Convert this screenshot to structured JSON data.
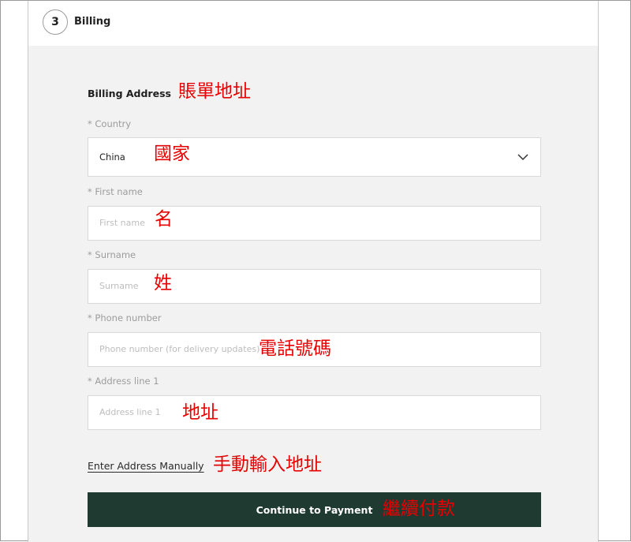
{
  "step": {
    "number": "3",
    "title": "Billing"
  },
  "billing": {
    "section_title": "Billing Address",
    "section_annotation": "賬單地址",
    "fields": {
      "country": {
        "label": "* Country",
        "value": "China",
        "annotation": "國家"
      },
      "first_name": {
        "label": "* First name",
        "placeholder": "First name",
        "annotation": "名"
      },
      "surname": {
        "label": "* Surname",
        "placeholder": "Surname",
        "annotation": "姓"
      },
      "phone": {
        "label": "* Phone number",
        "placeholder": "Phone number (for delivery updates)",
        "annotation": "電話號碼"
      },
      "address1": {
        "label": "* Address line 1",
        "placeholder": "Address line 1",
        "annotation": "地址"
      }
    },
    "manual_link": {
      "label": "Enter Address Manually",
      "annotation": "手動輸入地址"
    },
    "continue_button": {
      "label": "Continue to Payment",
      "annotation": "繼續付款"
    }
  },
  "colors": {
    "button_bg": "#1f3a30",
    "annotation": "#e60000",
    "form_bg": "#f2f2f2"
  }
}
